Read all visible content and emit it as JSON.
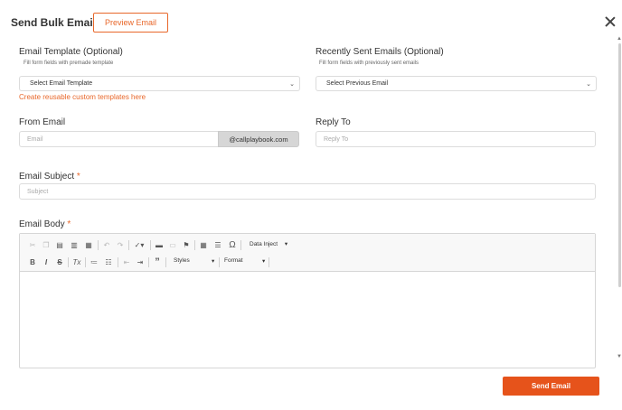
{
  "header": {
    "title": "Send Bulk Email",
    "preview_label": "Preview Email"
  },
  "template": {
    "label": "Email Template (Optional)",
    "hint": "Fill form fields with premade template",
    "selected": "Select Email Template",
    "link": "Create reusable custom templates here"
  },
  "recent": {
    "label": "Recently Sent Emails (Optional)",
    "hint": "Fill form fields with previously sent emails",
    "selected": "Select Previous Email"
  },
  "from": {
    "label": "From Email",
    "placeholder": "Email",
    "domain": "@callplaybook.com"
  },
  "reply": {
    "label": "Reply To",
    "placeholder": "Reply To"
  },
  "subject": {
    "label": "Email Subject",
    "required": "*",
    "placeholder": "Subject"
  },
  "body": {
    "label": "Email Body",
    "required": "*"
  },
  "toolbar": {
    "data_inject": "Data Inject",
    "styles": "Styles",
    "format": "Format",
    "bold": "B",
    "italic": "I",
    "strike": "S",
    "omega": "Ω",
    "quote": "”"
  },
  "footer": {
    "send_label": "Send Email"
  },
  "colors": {
    "accent": "#e8672a",
    "send": "#e6531b"
  }
}
